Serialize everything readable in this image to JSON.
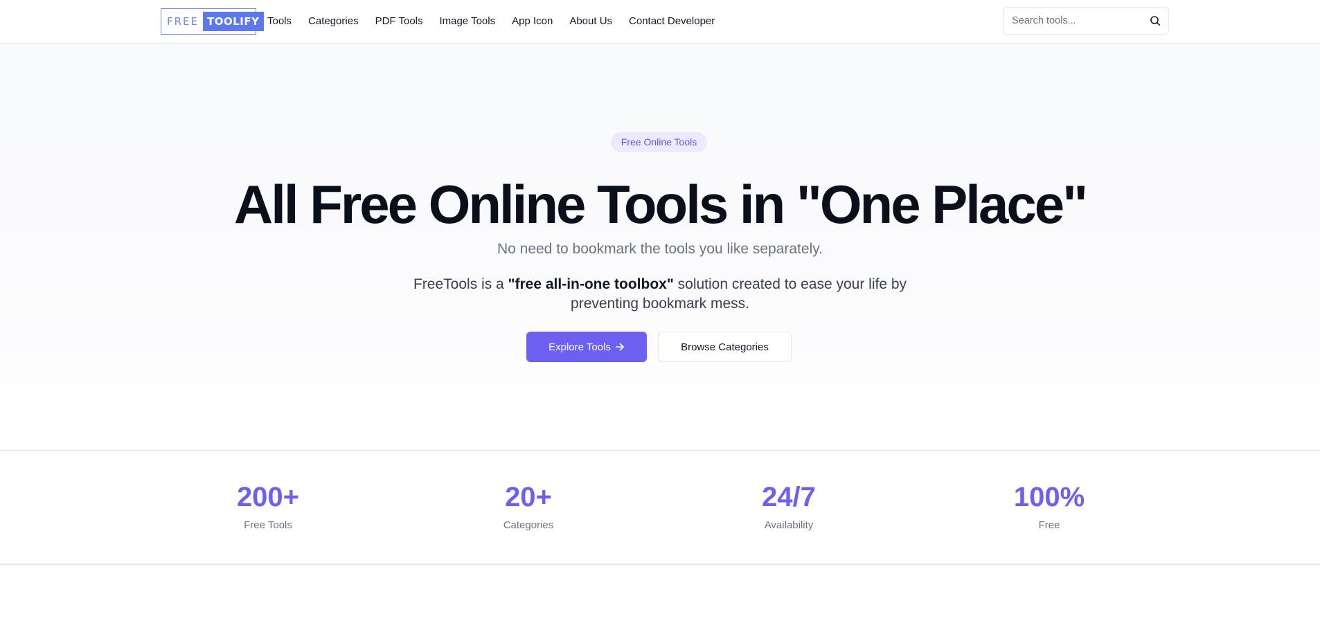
{
  "logo": {
    "part1": "FREE",
    "part2": "TOOLIFY"
  },
  "nav": {
    "items": [
      "Tools",
      "Categories",
      "PDF Tools",
      "Image Tools",
      "App Icon",
      "About Us",
      "Contact Developer"
    ]
  },
  "search": {
    "placeholder": "Search tools..."
  },
  "hero": {
    "badge": "Free Online Tools",
    "headline_main": "All Free Online Tools in ",
    "headline_highlight": "\"One Place\"",
    "subtitle": "No need to bookmark the tools you like separately.",
    "desc_prefix": "FreeTools is a ",
    "desc_bold": "\"free all-in-one toolbox\"",
    "desc_suffix": " solution created to ease your life by preventing bookmark mess.",
    "primary_button": "Explore Tools",
    "secondary_button": "Browse Categories"
  },
  "stats": [
    {
      "value": "200+",
      "label": "Free Tools"
    },
    {
      "value": "20+",
      "label": "Categories"
    },
    {
      "value": "24/7",
      "label": "Availability"
    },
    {
      "value": "100%",
      "label": "Free"
    }
  ],
  "colors": {
    "accent": "#6d5ff0",
    "logo_blue": "#5b78f0",
    "highlight_underline": "#c4b5fd",
    "badge_bg": "#ede9fe"
  },
  "icons": {
    "search": "search-icon",
    "arrow": "arrow-right-icon"
  }
}
